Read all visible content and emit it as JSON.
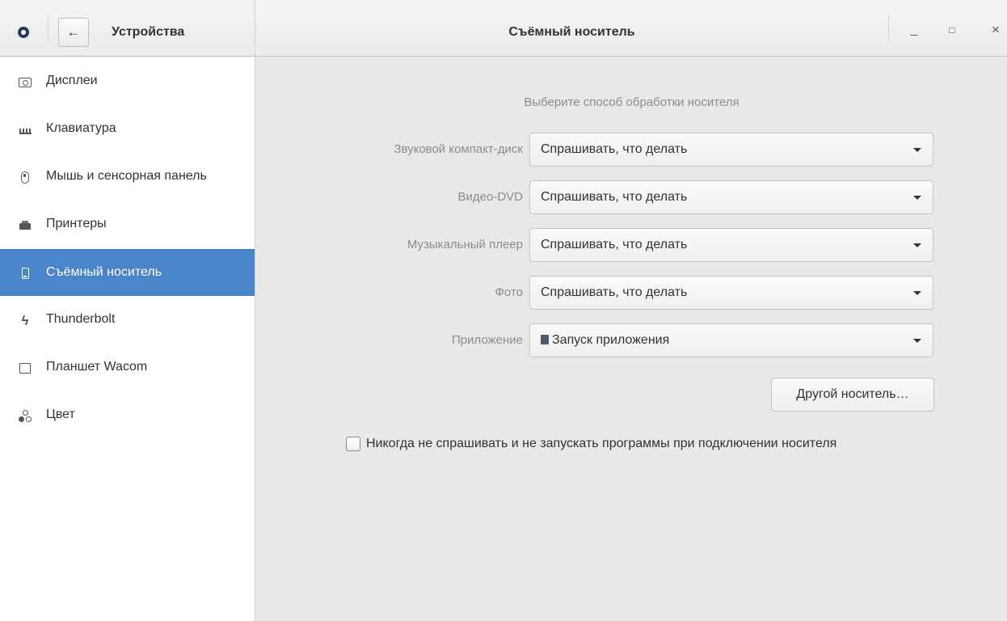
{
  "header": {
    "panel_title": "Устройства",
    "back_glyph": "←",
    "title": "Съёмный носитель",
    "window_controls": {
      "minimize": "_",
      "maximize": "□",
      "close": "×"
    }
  },
  "sidebar": {
    "items": [
      {
        "label": "Дисплеи",
        "icon": "display-icon"
      },
      {
        "label": "Клавиатура",
        "icon": "keyboard-icon"
      },
      {
        "label": "Мышь и сенсорная панель",
        "icon": "mouse-icon"
      },
      {
        "label": "Принтеры",
        "icon": "printer-icon"
      },
      {
        "label": "Съёмный носитель",
        "icon": "removable-media-icon",
        "selected": true
      },
      {
        "label": "Thunderbolt",
        "icon": "thunderbolt-icon",
        "glyph": "ϟ"
      },
      {
        "label": "Планшет Wacom",
        "icon": "wacom-tablet-icon"
      },
      {
        "label": "Цвет",
        "icon": "color-icon"
      }
    ],
    "selected_color": "#4a84c9"
  },
  "main": {
    "heading": "Выберите способ обработки носителя",
    "rows": [
      {
        "label": "Звуковой компакт-диск",
        "value": "Спрашивать, что делать"
      },
      {
        "label": "Видео-DVD",
        "value": "Спрашивать, что делать"
      },
      {
        "label": "Музыкальный плеер",
        "value": "Спрашивать, что делать"
      },
      {
        "label": "Фото",
        "value": "Спрашивать, что делать"
      },
      {
        "label": "Приложение",
        "value": "Запуск приложения",
        "value_icon": "application-icon"
      }
    ],
    "other_media_button": "Другой носитель…",
    "never_ask_checkbox": {
      "label": "Никогда не спрашивать и не запускать программы при подключении носителя",
      "checked": false
    }
  }
}
